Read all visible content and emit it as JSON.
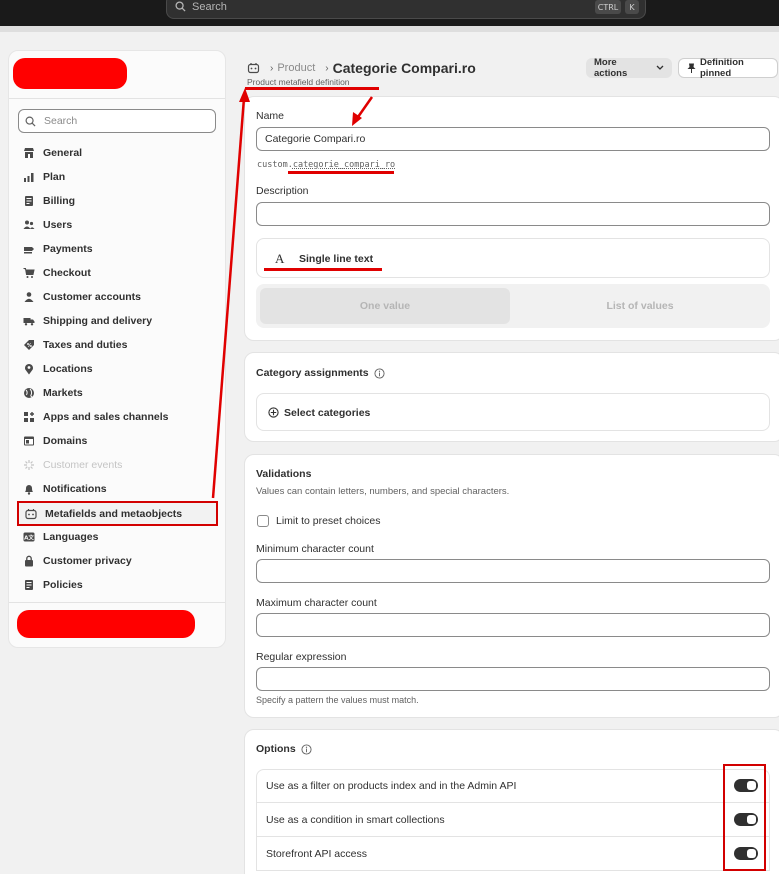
{
  "topbar": {
    "search_placeholder": "Search",
    "kbd_ctrl": "CTRL",
    "kbd_k": "K"
  },
  "sidebar": {
    "search_placeholder": "Search",
    "items": [
      {
        "label": "General",
        "icon": "store-icon"
      },
      {
        "label": "Plan",
        "icon": "plan-icon"
      },
      {
        "label": "Billing",
        "icon": "billing-icon"
      },
      {
        "label": "Users",
        "icon": "users-icon"
      },
      {
        "label": "Payments",
        "icon": "payments-icon"
      },
      {
        "label": "Checkout",
        "icon": "cart-icon"
      },
      {
        "label": "Customer accounts",
        "icon": "person-icon"
      },
      {
        "label": "Shipping and delivery",
        "icon": "truck-icon"
      },
      {
        "label": "Taxes and duties",
        "icon": "tax-icon"
      },
      {
        "label": "Locations",
        "icon": "location-icon"
      },
      {
        "label": "Markets",
        "icon": "globe-icon"
      },
      {
        "label": "Apps and sales channels",
        "icon": "apps-icon"
      },
      {
        "label": "Domains",
        "icon": "domain-icon"
      },
      {
        "label": "Customer events",
        "icon": "events-icon"
      },
      {
        "label": "Notifications",
        "icon": "bell-icon"
      },
      {
        "label": "Metafields and metaobjects",
        "icon": "metafields-icon"
      },
      {
        "label": "Languages",
        "icon": "language-icon"
      },
      {
        "label": "Customer privacy",
        "icon": "lock-icon"
      },
      {
        "label": "Policies",
        "icon": "policy-icon"
      }
    ]
  },
  "header": {
    "breadcrumb": "Product",
    "title": "Categorie Compari.ro",
    "subtitle": "Product metafield definition",
    "more_actions": "More actions",
    "pinned": "Definition pinned"
  },
  "definition": {
    "name_label": "Name",
    "name_value": "Categorie Compari.ro",
    "namespace_prefix": "custom.",
    "namespace_key": "categorie_compari_ro",
    "description_label": "Description",
    "description_value": "",
    "type_glyph": "A",
    "type_label": "Single line text",
    "one_value": "One value",
    "list_values": "List of values"
  },
  "category": {
    "title": "Category assignments",
    "select": "Select categories"
  },
  "validations": {
    "title": "Validations",
    "help": "Values can contain letters, numbers, and special characters.",
    "limit_label": "Limit to preset choices",
    "min_label": "Minimum character count",
    "max_label": "Maximum character count",
    "regex_label": "Regular expression",
    "regex_help": "Specify a pattern the values must match."
  },
  "options": {
    "title": "Options",
    "rows": [
      {
        "label": "Use as a filter on products index and in the Admin API",
        "on": true
      },
      {
        "label": "Use as a condition in smart collections",
        "on": true
      },
      {
        "label": "Storefront API access",
        "on": true
      }
    ]
  },
  "colors": {
    "accent_dark": "#303030",
    "annotation_red": "#e00000",
    "page_bg": "#f1f1f1"
  }
}
